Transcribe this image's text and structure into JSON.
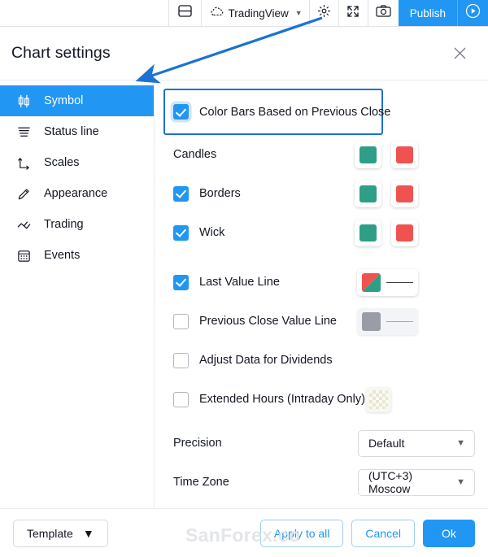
{
  "toolbar": {
    "layout_icon": "layout-split-icon",
    "source_label": "TradingView",
    "source_icon": "cloud-dashed-icon",
    "gear_icon": "gear-icon",
    "expand_icon": "fullscreen-icon",
    "camera_icon": "camera-icon",
    "publish_label": "Publish",
    "play_icon": "play-circle-icon"
  },
  "dialog": {
    "title": "Chart settings",
    "close_icon": "close-icon"
  },
  "sidebar": {
    "items": [
      {
        "label": "Symbol",
        "icon": "candlestick-icon",
        "active": true
      },
      {
        "label": "Status line",
        "icon": "status-lines-icon",
        "active": false
      },
      {
        "label": "Scales",
        "icon": "axes-icon",
        "active": false
      },
      {
        "label": "Appearance",
        "icon": "pencil-icon",
        "active": false
      },
      {
        "label": "Trading",
        "icon": "zigzag-icon",
        "active": false
      },
      {
        "label": "Events",
        "icon": "calendar-icon",
        "active": false
      }
    ]
  },
  "settings": {
    "color_bars": {
      "label": "Color Bars Based on Previous Close",
      "checked": true,
      "highlighted": true
    },
    "candles": {
      "label": "Candles",
      "has_checkbox": false,
      "up_color": "#2e9e87",
      "down_color": "#ef5350"
    },
    "borders": {
      "label": "Borders",
      "checked": true,
      "up_color": "#2e9e87",
      "down_color": "#ef5350"
    },
    "wick": {
      "label": "Wick",
      "checked": true,
      "up_color": "#2e9e87",
      "down_color": "#ef5350"
    },
    "last_value_line": {
      "label": "Last Value Line",
      "checked": true,
      "up_color": "#2e9e87",
      "down_color": "#ef5350"
    },
    "prev_close_line": {
      "label": "Previous Close Value Line",
      "checked": false,
      "color": "#9a9da6"
    },
    "adjust_dividends": {
      "label": "Adjust Data for Dividends",
      "checked": false
    },
    "extended_hours": {
      "label": "Extended Hours (Intraday Only)",
      "checked": false,
      "swatch": "checkerboard"
    },
    "precision": {
      "label": "Precision",
      "value": "Default"
    },
    "timezone": {
      "label": "Time Zone",
      "value": "(UTC+3) Moscow"
    }
  },
  "footer": {
    "template_label": "Template",
    "apply_all_label": "Apply to all",
    "cancel_label": "Cancel",
    "ok_label": "Ok"
  },
  "annotation": {
    "watermark": "SanForex.co",
    "arrow_color": "#1b72d4"
  }
}
